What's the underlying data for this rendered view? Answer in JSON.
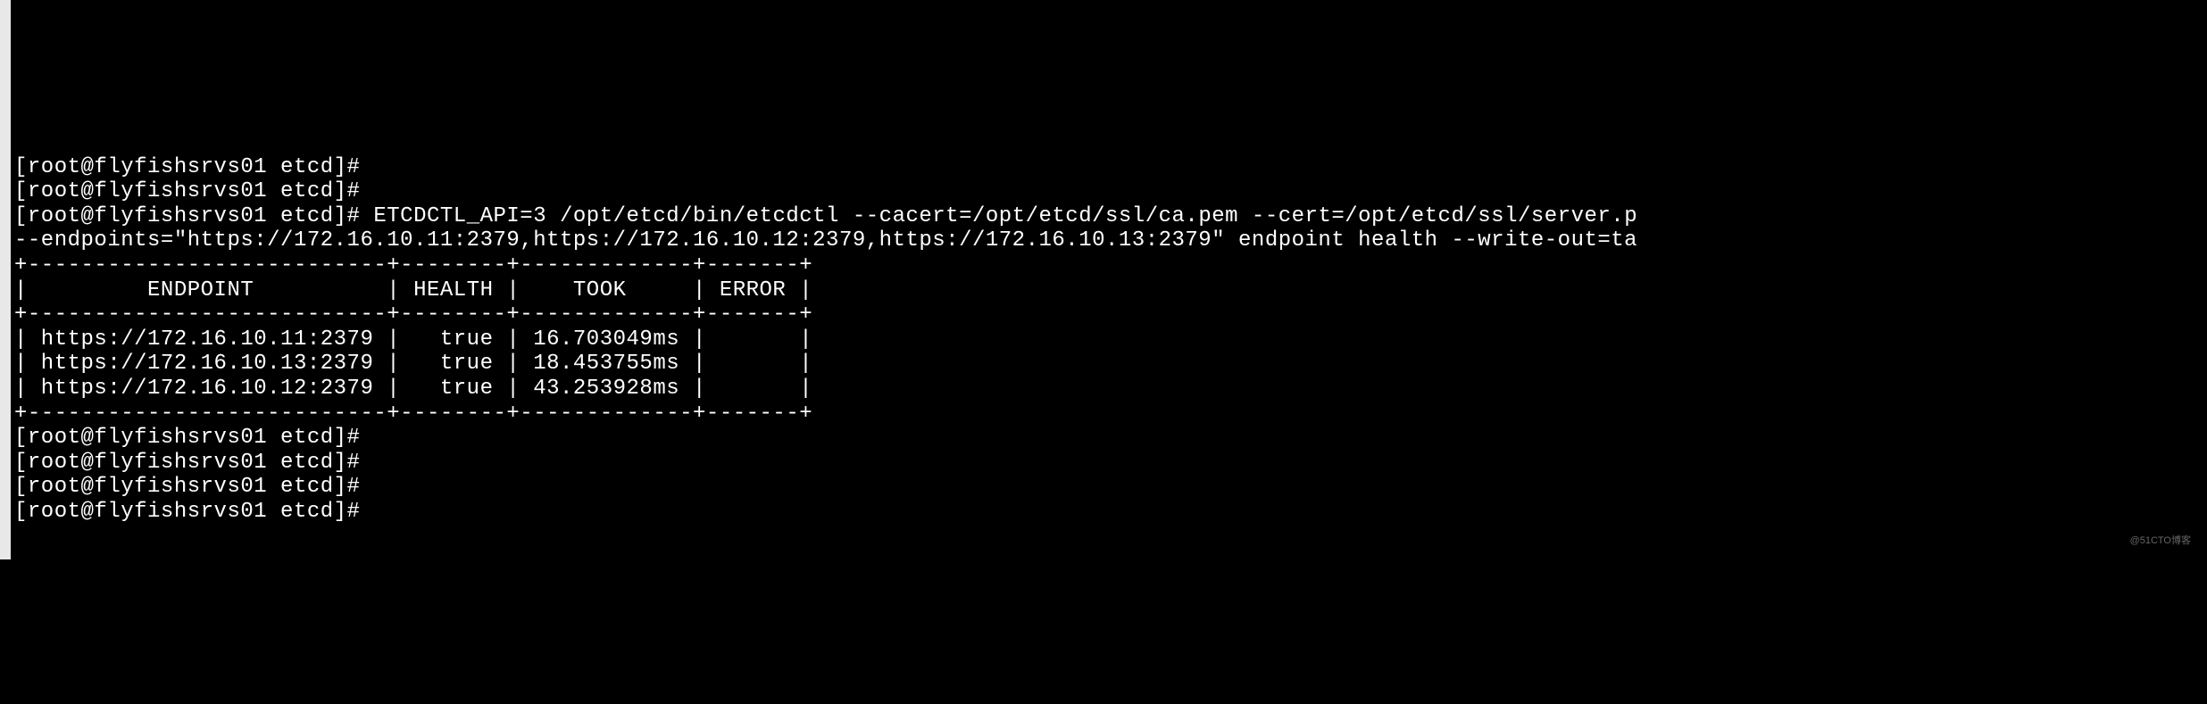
{
  "prompt": "[root@flyfishsrvs01 etcd]#",
  "command_line1": " ETCDCTL_API=3 /opt/etcd/bin/etcdctl --cacert=/opt/etcd/ssl/ca.pem --cert=/opt/etcd/ssl/server.p",
  "command_line2": "--endpoints=\"https://172.16.10.11:2379,https://172.16.10.12:2379,https://172.16.10.13:2379\" endpoint health --write-out=ta",
  "table": {
    "border_top": "+---------------------------+--------+-------------+-------+",
    "header_row": "|         ENDPOINT          | HEALTH |    TOOK     | ERROR |",
    "border_mid": "+---------------------------+--------+-------------+-------+",
    "row1": "| https://172.16.10.11:2379 |   true | 16.703049ms |       |",
    "row2": "| https://172.16.10.13:2379 |   true | 18.453755ms |       |",
    "row3": "| https://172.16.10.12:2379 |   true | 43.253928ms |       |",
    "border_bot": "+---------------------------+--------+-------------+-------+"
  },
  "watermark": "@51CTO博客",
  "chart_data": {
    "type": "table",
    "title": "etcd endpoint health",
    "columns": [
      "ENDPOINT",
      "HEALTH",
      "TOOK",
      "ERROR"
    ],
    "rows": [
      {
        "ENDPOINT": "https://172.16.10.11:2379",
        "HEALTH": "true",
        "TOOK": "16.703049ms",
        "ERROR": ""
      },
      {
        "ENDPOINT": "https://172.16.10.13:2379",
        "HEALTH": "true",
        "TOOK": "18.453755ms",
        "ERROR": ""
      },
      {
        "ENDPOINT": "https://172.16.10.12:2379",
        "HEALTH": "true",
        "TOOK": "43.253928ms",
        "ERROR": ""
      }
    ]
  }
}
